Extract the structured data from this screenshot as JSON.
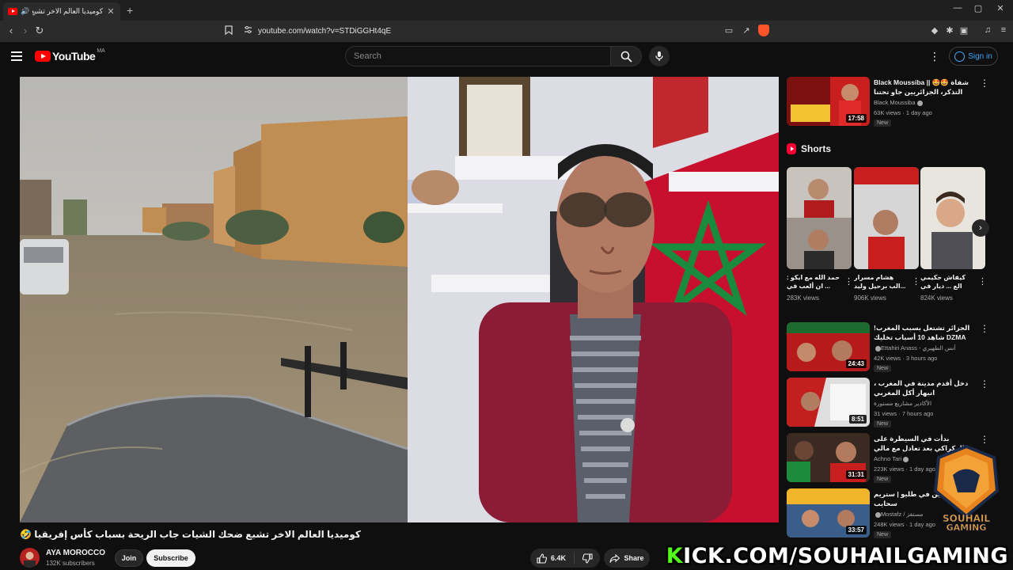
{
  "browser": {
    "tab_title": "كوميديا العالم الاخر تشبع ضحك",
    "url": "youtube.com/watch?v=STDiGGHt4qE"
  },
  "header": {
    "logo_text": "YouTube",
    "country_code": "MA",
    "search_placeholder": "Search",
    "signin_label": "Sign in"
  },
  "video": {
    "title": "كوميديا العالم الاخر تشبع ضحك الشيات جاب الريحة بسباب كأس إفريقيا 🤣",
    "channel_name": "AYA MOROCCO",
    "subscribers": "132K subscribers",
    "join_label": "Join",
    "subscribe_label": "Subscribe",
    "likes": "6.4K",
    "share_label": "Share"
  },
  "sidebar": {
    "recommendations": [
      {
        "title": "Black Moussiba || 🤩🤩 شفاة التذكر، الجزائريين جاو تحتنا",
        "channel": "Black Moussiba",
        "views": "63K views",
        "age": "1 day ago",
        "duration": "17:58",
        "badge": "New"
      },
      {
        "title": "الجزائر تشتعل بسبب المغرب! DZMA شاهد 10 أسباب تخليك تشجعهم وصدمة مراسلهم",
        "channel": "Ettahiri Anass - أنس الطهيري",
        "views": "42K views",
        "age": "3 hours ago",
        "duration": "24:43",
        "badge": "New"
      },
      {
        "title": "دخل أقدم مدينة في المغرب ، انبهار أكل المغربي",
        "channel": "الأكادير مشاريع مستورة",
        "views": "31 views",
        "age": "7 hours ago",
        "duration": "8:51",
        "badge": "New"
      },
      {
        "title": "بدأت في السيطرة على الركراكي بعد تعادل مع مالي ومخليش أشنو قالو ليه",
        "channel": "Achno Tari",
        "views": "223K views",
        "age": "1 day ago",
        "duration": "31:31",
        "badge": "New"
      },
      {
        "title": "صلت كمين في طليو | ستريم سحايب",
        "channel": "Mostafz / مستفز",
        "views": "248K views",
        "age": "1 day ago",
        "duration": "33:57",
        "badge": "New"
      }
    ],
    "shorts_heading": "Shorts",
    "shorts": [
      {
        "title": "حمد الله مع ايكو : ... ان ألعب في",
        "views": "283K views"
      },
      {
        "title": "هشام مسرار ...الب برحيل وليد",
        "views": "906K views"
      },
      {
        "title": "كيفاش حكيمي الع ... ديار في تمثيل",
        "views": "824K views"
      }
    ]
  },
  "overlays": {
    "gaming_logo_line1": "SOUHAIL",
    "gaming_logo_line2": "GAMING",
    "kick_k": "K",
    "kick_rest": "ICK.COM/SOUHAILGAMING"
  },
  "colors": {
    "background": "#0f0f0f",
    "youtube_red": "#ff0000",
    "signin_blue": "#3ea6ff",
    "kick_green": "#53fc18"
  }
}
